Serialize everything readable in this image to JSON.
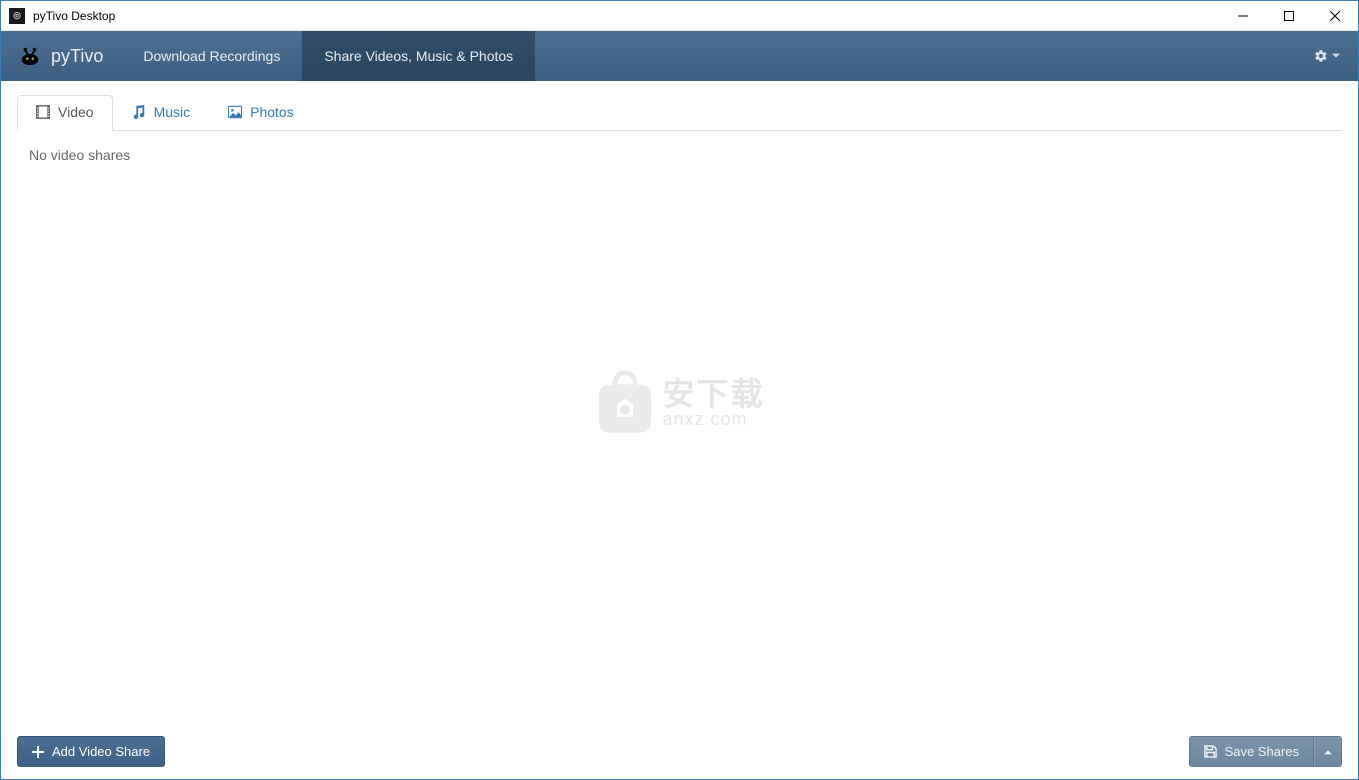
{
  "window": {
    "title": "pyTivo Desktop"
  },
  "brand": {
    "name": "pyTivo"
  },
  "nav": {
    "items": [
      {
        "label": "Download Recordings",
        "active": false
      },
      {
        "label": "Share Videos, Music & Photos",
        "active": true
      }
    ]
  },
  "tabs": {
    "items": [
      {
        "label": "Video",
        "icon": "film-icon",
        "active": true
      },
      {
        "label": "Music",
        "icon": "music-icon",
        "active": false
      },
      {
        "label": "Photos",
        "icon": "picture-icon",
        "active": false
      }
    ]
  },
  "content": {
    "empty_message": "No video shares"
  },
  "footer": {
    "add_label": "Add Video Share",
    "save_label": "Save Shares"
  },
  "watermark": {
    "line1": "安下载",
    "line2": "anxz.com"
  }
}
